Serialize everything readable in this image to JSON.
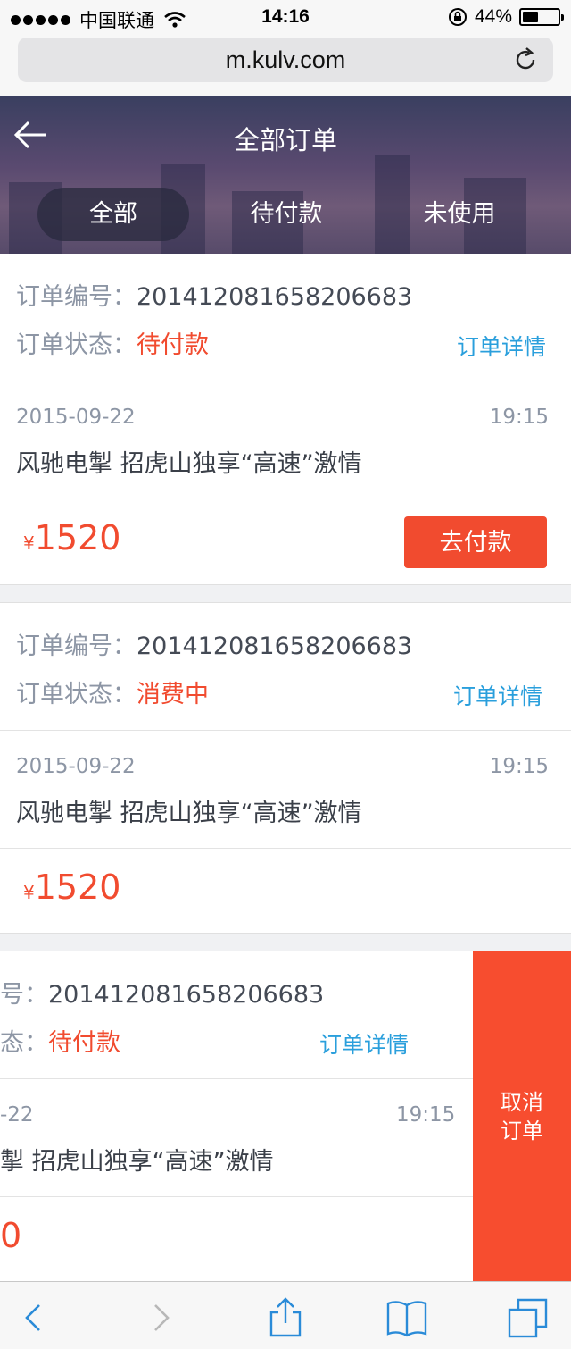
{
  "status_bar": {
    "carrier": "中国联通",
    "time": "14:16",
    "battery": "44%",
    "battery_level": 0.44
  },
  "browser": {
    "url": "m.kulv.com"
  },
  "header": {
    "title": "全部订单",
    "tabs": [
      {
        "label": "全部",
        "active": true
      },
      {
        "label": "待付款",
        "active": false
      },
      {
        "label": "未使用",
        "active": false
      }
    ]
  },
  "orders": [
    {
      "number_label": "订单编号：",
      "number": "201412081658206683",
      "status_label": "订单状态：",
      "status": "待付款",
      "detail_link": "订单详情",
      "date": "2015-09-22",
      "time": "19:15",
      "title": "风驰电掣 招虎山独享“高速”激情",
      "currency": "¥",
      "price": "1520",
      "action": "去付款"
    },
    {
      "number_label": "订单编号：",
      "number": "201412081658206683",
      "status_label": "订单状态：",
      "status": "消费中",
      "detail_link": "订单详情",
      "date": "2015-09-22",
      "time": "19:15",
      "title": "风驰电掣 招虎山独享“高速”激情",
      "currency": "¥",
      "price": "1520"
    },
    {
      "number_label": "号：",
      "number": "201412081658206683",
      "status_label": "态：",
      "status": "待付款",
      "detail_link": "订单详情",
      "date": "-22",
      "time": "19:15",
      "title": "掣 招虎山独享“高速”激情",
      "price": "0",
      "swipe_action": "取消订单",
      "swipe_action_lines": [
        "取消",
        "订单"
      ]
    }
  ],
  "colors": {
    "accent_red": "#f14b2f",
    "link_blue": "#2a9fdc",
    "label_gray": "#8d96a5"
  },
  "toolbar_icons": [
    "back-icon",
    "forward-icon",
    "share-icon",
    "bookmarks-icon",
    "tabs-icon"
  ]
}
